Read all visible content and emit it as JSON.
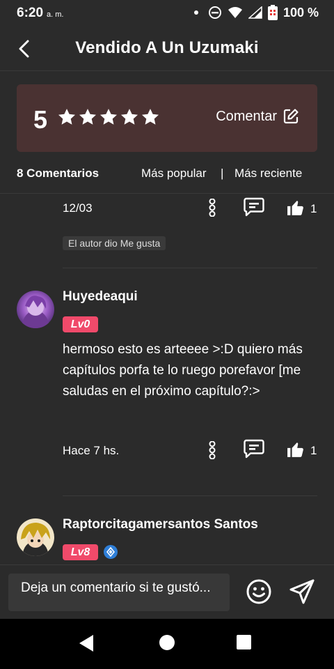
{
  "status": {
    "time": "6:20",
    "ampm": "a. m.",
    "battery_pct": "100 %"
  },
  "appbar": {
    "title": "Vendido A Un Uzumaki",
    "back_icon": "chevron-left-icon"
  },
  "rating": {
    "value": "5",
    "stars": 5,
    "comment_label": "Comentar",
    "comment_icon": "edit-icon"
  },
  "comments_header": {
    "count_label": "8 Comentarios",
    "sort_popular": "Más popular",
    "separator": "|",
    "sort_recent": "Más reciente"
  },
  "comments": [
    {
      "timestamp": "12/03",
      "likes": "1",
      "author_badge": "El autor dio Me gusta"
    },
    {
      "username": "Huyedeaqui",
      "level": "Lv0",
      "text": "hermoso esto es arteeee >:D quiero más capítulos porfa te lo ruego porefavor [me saludas en el próximo capítulo?:>",
      "timestamp": "Hace 7 hs.",
      "likes": "1"
    },
    {
      "username": "Raptorcitagamersantos Santos",
      "level": "Lv8"
    }
  ],
  "input": {
    "placeholder": "Deja un comentario si te gustó..."
  },
  "colors": {
    "background": "#2b2b2b",
    "rating_card": "#4a3232",
    "level_badge": "#f04a6a",
    "verify_badge": "#2f7fd8"
  }
}
